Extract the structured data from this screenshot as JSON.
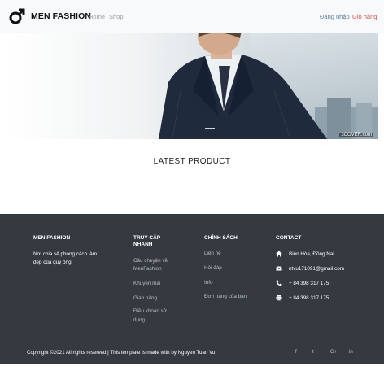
{
  "navbar": {
    "brand": "MEN FASHION",
    "links": [
      "Home",
      "Shop"
    ],
    "login": "Đăng nhập",
    "cart": "Giỏ hàng"
  },
  "hero": {
    "watermark": "3COVER.com"
  },
  "main": {
    "section_title": "LATEST PRODUCT"
  },
  "footer": {
    "brand_title": "MEN FASHION",
    "brand_desc_lines": [
      "Nơi chia sẻ phong cách làm",
      "đẹp của quý ông"
    ],
    "access_title_lines": [
      "TRUY CẬP",
      "NHANH"
    ],
    "access_links": [
      [
        "Câu chuyện về",
        "MenFashion"
      ],
      [
        "Khuyến mãi"
      ],
      [
        "Giao hàng"
      ],
      [
        "Điều khoản sử",
        "dụng"
      ]
    ],
    "policy_title": "CHÍNH SÁCH",
    "policy_links": [
      "Liên hệ",
      "Hỏi đáp",
      "Info",
      "Đơn hàng của bạn"
    ],
    "contact_title": "CONTACT",
    "contact": [
      {
        "icon": "home-icon",
        "text": "Biên Hòa, Đồng Nai"
      },
      {
        "icon": "envelope-icon",
        "text": "ntvu171091@gmail.com"
      },
      {
        "icon": "phone-icon",
        "text": "+ 84 398 317 175"
      },
      {
        "icon": "print-icon",
        "text": "+ 84 398 317 175"
      }
    ],
    "copyright": "Copyright ©2021 All rights reserved | This template is made with by Nguyen Tuan Vu",
    "social": [
      "f",
      "t",
      "G+",
      "in"
    ]
  }
}
